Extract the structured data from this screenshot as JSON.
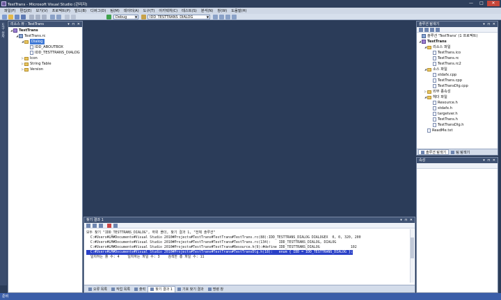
{
  "window": {
    "title": "TestTrans - Microsoft Visual Studio (관리자)",
    "minimize": "—",
    "maximize": "□",
    "close": "✕"
  },
  "menu": [
    "파일(F)",
    "편집(E)",
    "보기(V)",
    "프로젝트(P)",
    "빌드(B)",
    "디버그(D)",
    "팀(M)",
    "데이터(A)",
    "도구(T)",
    "아키텍처(C)",
    "테스트(S)",
    "분석(N)",
    "창(W)",
    "도움말(H)"
  ],
  "toolbar": {
    "config": "Debug",
    "find_combo": "IDD_TESTTRANS_DIALOG"
  },
  "left_strip": {
    "label": "도구 상자"
  },
  "resource_view": {
    "header": "리소스 뷰 - TestTrans",
    "tree": [
      {
        "label": "TestTrans",
        "level": 0,
        "expanded": true,
        "icon": "project",
        "bold": true
      },
      {
        "label": "TestTrans.rc",
        "level": 1,
        "expanded": true,
        "icon": "rc"
      },
      {
        "label": "Dialog",
        "level": 2,
        "expanded": true,
        "icon": "folder",
        "selected": true
      },
      {
        "label": "IDD_ABOUTBOX",
        "level": 3,
        "icon": "file"
      },
      {
        "label": "IDD_TESTTRANS_DIALOG",
        "level": 3,
        "icon": "file"
      },
      {
        "label": "Icon",
        "level": 2,
        "expanded": false,
        "icon": "folder"
      },
      {
        "label": "String Table",
        "level": 2,
        "expanded": false,
        "icon": "folder"
      },
      {
        "label": "Version",
        "level": 2,
        "expanded": false,
        "icon": "folder"
      }
    ]
  },
  "solution_explorer": {
    "header": "솔루션 탐색기",
    "tree": [
      {
        "label": "솔루션 'TestTrans' (1 프로젝트)",
        "level": 0,
        "icon": "rc"
      },
      {
        "label": "TestTrans",
        "level": 0,
        "expanded": true,
        "icon": "project",
        "bold": true
      },
      {
        "label": "리소스 파일",
        "level": 1,
        "expanded": true,
        "icon": "folder"
      },
      {
        "label": "TestTrans.ico",
        "level": 2,
        "icon": "file"
      },
      {
        "label": "TestTrans.rc",
        "level": 2,
        "icon": "file"
      },
      {
        "label": "TestTrans.rc2",
        "level": 2,
        "icon": "file"
      },
      {
        "label": "소스 파일",
        "level": 1,
        "expanded": true,
        "icon": "folder"
      },
      {
        "label": "stdafx.cpp",
        "level": 2,
        "icon": "file"
      },
      {
        "label": "TestTrans.cpp",
        "level": 2,
        "icon": "file"
      },
      {
        "label": "TestTransDlg.cpp",
        "level": 2,
        "icon": "file"
      },
      {
        "label": "외부 종속성",
        "level": 1,
        "expanded": false,
        "icon": "folder"
      },
      {
        "label": "헤더 파일",
        "level": 1,
        "expanded": true,
        "icon": "folder"
      },
      {
        "label": "Resource.h",
        "level": 2,
        "icon": "file"
      },
      {
        "label": "stdafx.h",
        "level": 2,
        "icon": "file"
      },
      {
        "label": "targetver.h",
        "level": 2,
        "icon": "file"
      },
      {
        "label": "TestTrans.h",
        "level": 2,
        "icon": "file"
      },
      {
        "label": "TestTransDlg.h",
        "level": 2,
        "icon": "file"
      },
      {
        "label": "ReadMe.txt",
        "level": 1,
        "icon": "file"
      }
    ],
    "tabs": [
      "솔루션 탐색기",
      "팀 탐색기"
    ]
  },
  "properties": {
    "header": "속성"
  },
  "find_results": {
    "header": "찾기 결과 1",
    "lines": [
      {
        "text": "모두 찾기 \"IDD_TESTTRANS_DIALOG\", 하위 폴더, 찾기 결과 1, \"전체 솔루션\"",
        "highlight": false
      },
      {
        "text": "  C:#Users#LM#Documents#Visual Studio 2010#Projects#TestTrans#TestTrans#TestTrans.rc(88):IDD_TESTTRANS_DIALOG DIALOGEX  0, 0, 320, 200",
        "highlight": false
      },
      {
        "text": "  C:#Users#LM#Documents#Visual Studio 2010#Projects#TestTrans#TestTrans#TestTrans.rc(134):    IDD_TESTTRANS_DIALOG, DIALOG",
        "highlight": false
      },
      {
        "text": "  C:#Users#LM#Documents#Visual Studio 2010#Projects#TestTrans#TestTrans#Resource.h(9):#define IDD_TESTTRANS_DIALOG               102",
        "highlight": false
      },
      {
        "text": "  C:#Users#LM#Documents#Visual Studio 2010#Projects#TestTrans#TestTrans#TestTransDlg.h(18):   enum { IDD = IDD_TESTTRANS_DIALOG };",
        "highlight": true
      },
      {
        "text": "  일치하는 줄 수: 4    일치하는 파일 수: 3    검색한 총 파일 수: 11",
        "highlight": false
      }
    ]
  },
  "bottom_tabs": [
    {
      "label": "오류 목록",
      "active": false
    },
    {
      "label": "작업 목록",
      "active": false
    },
    {
      "label": "출력",
      "active": false
    },
    {
      "label": "찾기 결과 1",
      "active": true
    },
    {
      "label": "기호 찾기 결과",
      "active": false
    },
    {
      "label": "명령 창",
      "active": false
    }
  ],
  "status": "준비"
}
